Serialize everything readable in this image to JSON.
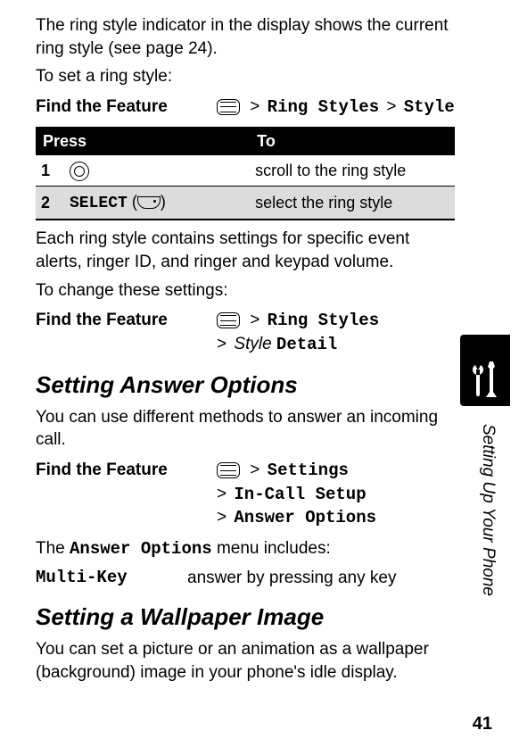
{
  "intro1": "The ring style indicator in the display shows the current ring style (see page 24).",
  "intro2": "To set a ring style:",
  "feature_label": "Find the Feature",
  "sep": ">",
  "path1": {
    "a": "Ring Styles",
    "z": "Style"
  },
  "table": {
    "head_press": "Press",
    "head_to": "To",
    "r1_num": "1",
    "r1_to": "scroll to the ring style",
    "r2_num": "2",
    "r2_key": "SELECT",
    "r2_to": "select the ring style"
  },
  "mid1": "Each ring style contains settings for specific event alerts, ringer ID, and ringer and keypad volume.",
  "mid2": "To change these settings:",
  "path2": {
    "a": "Ring Styles",
    "b": "Style",
    "c": "Detail"
  },
  "h_answer": "Setting Answer Options",
  "answer_intro": "You can use different methods to answer an incoming call.",
  "path3": {
    "a": "Settings",
    "b": "In-Call Setup",
    "c": "Answer Options"
  },
  "answer_line_pre": "The ",
  "answer_line_mono": "Answer Options",
  "answer_line_post": " menu includes:",
  "opt": {
    "key": "Multi-Key",
    "val": "answer by pressing any key"
  },
  "h_wall": "Setting a Wallpaper Image",
  "wall_p": "You can set a picture or an animation as a wallpaper (background) image in your phone's idle display.",
  "side": "Setting Up Your Phone",
  "page": "41"
}
